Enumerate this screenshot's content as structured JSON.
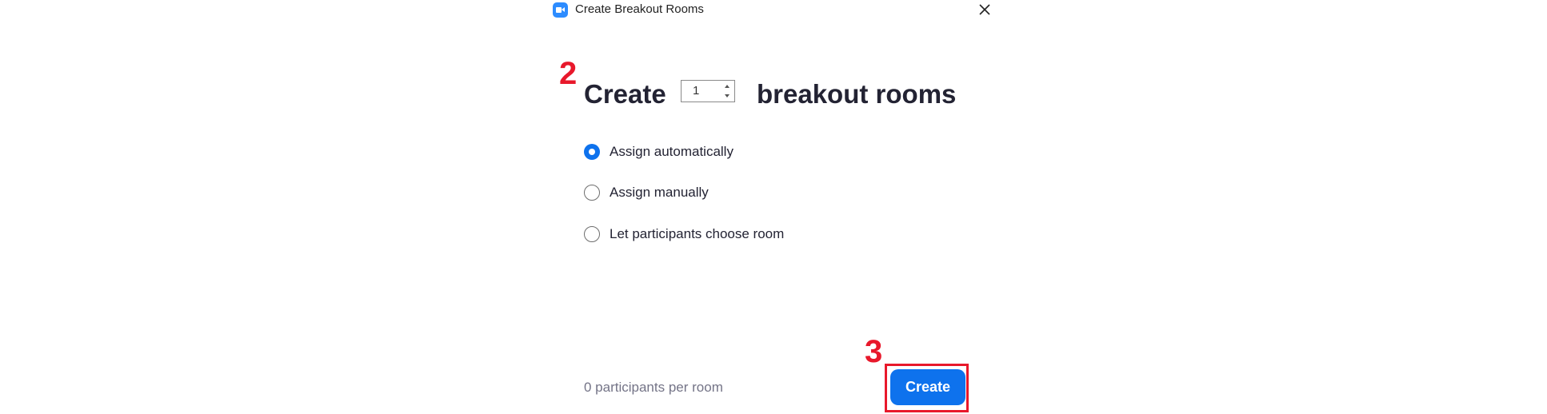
{
  "window": {
    "title": "Create Breakout Rooms",
    "icon": "zoom-camera-icon",
    "close_icon": "close-icon"
  },
  "annotations": {
    "step_a": "2",
    "step_b": "3",
    "highlight_color": "#e8182b"
  },
  "heading": {
    "prefix": "Create",
    "room_count": "1",
    "suffix": "breakout rooms"
  },
  "options": [
    {
      "label": "Assign automatically",
      "selected": true
    },
    {
      "label": "Assign manually",
      "selected": false
    },
    {
      "label": "Let participants choose room",
      "selected": false
    }
  ],
  "footer": {
    "participants_text": "0 participants per room",
    "create_label": "Create"
  },
  "colors": {
    "accent": "#0e72ed",
    "brand": "#2D8CFF"
  }
}
